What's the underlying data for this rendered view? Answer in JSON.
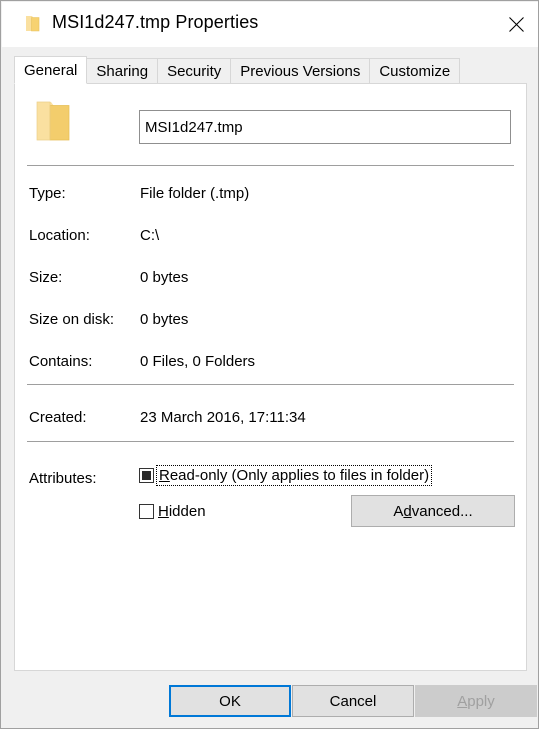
{
  "window": {
    "title": "MSI1d247.tmp Properties",
    "icon": "folder-icon",
    "close_label": "✕"
  },
  "tabs": [
    {
      "label": "General",
      "active": true
    },
    {
      "label": "Sharing",
      "active": false
    },
    {
      "label": "Security",
      "active": false
    },
    {
      "label": "Previous Versions",
      "active": false
    },
    {
      "label": "Customize",
      "active": false
    }
  ],
  "general": {
    "name_value": "MSI1d247.tmp",
    "rows": [
      {
        "label": "Type:",
        "value": "File folder (.tmp)"
      },
      {
        "label": "Location:",
        "value": "C:\\"
      },
      {
        "label": "Size:",
        "value": "0 bytes"
      },
      {
        "label": "Size on disk:",
        "value": "0 bytes"
      },
      {
        "label": "Contains:",
        "value": "0 Files, 0 Folders"
      }
    ],
    "created": {
      "label": "Created:",
      "value": "23 March 2016, 17:11:34"
    },
    "attributes": {
      "label": "Attributes:",
      "readonly": {
        "text": "Read-only (Only applies to files in folder)",
        "accesskey": "R",
        "state": "indeterminate",
        "focused": true
      },
      "hidden": {
        "text": "Hidden",
        "accesskey": "H",
        "state": "unchecked",
        "focused": false
      },
      "advanced_label": "Advanced...",
      "advanced_accesskey": "d"
    }
  },
  "footer": {
    "ok_label": "OK",
    "cancel_label": "Cancel",
    "apply_label": "Apply",
    "apply_accesskey": "A",
    "apply_disabled": true
  },
  "colors": {
    "accent": "#0078d7",
    "dialog_bg": "#f0f0f0",
    "panel_bg": "#ffffff",
    "folder_yellow": "#f7d271",
    "folder_yellow_light": "#fae0a0",
    "separator": "#9e9e9e",
    "button_face": "#e1e1e1",
    "disabled_text": "#a0a0a0"
  }
}
